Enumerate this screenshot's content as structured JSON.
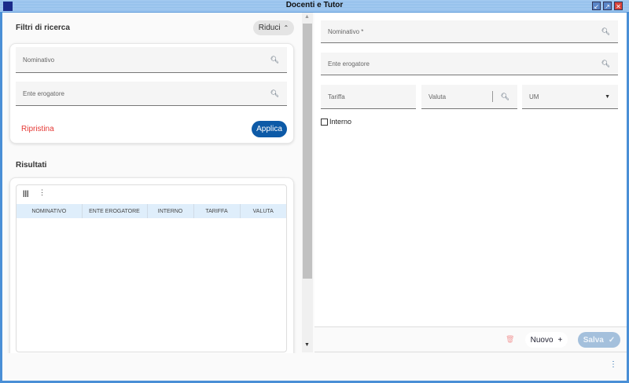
{
  "window": {
    "title": "Docenti e Tutor"
  },
  "filters": {
    "title": "Filtri di ricerca",
    "collapse_label": "Riduci",
    "nominativo_placeholder": "Nominativo",
    "ente_placeholder": "Ente erogatore",
    "reset_label": "Ripristina",
    "apply_label": "Applica"
  },
  "results": {
    "title": "Risultati",
    "columns": [
      "NOMINATIVO",
      "ENTE EROGATORE",
      "INTERNO",
      "TARIFFA",
      "VALUTA"
    ]
  },
  "detail": {
    "nominativo_placeholder": "Nominativo *",
    "ente_placeholder": "Ente erogatore",
    "tariffa_placeholder": "Tariffa",
    "valuta_placeholder": "Valuta",
    "um_placeholder": "UM",
    "interno_label": "Interno",
    "interno_checked": false
  },
  "actions": {
    "new_label": "Nuovo",
    "save_label": "Salva"
  },
  "colors": {
    "accent": "#0d5aa7",
    "reset": "#e53935",
    "save_disabled": "#a4c0dc"
  }
}
